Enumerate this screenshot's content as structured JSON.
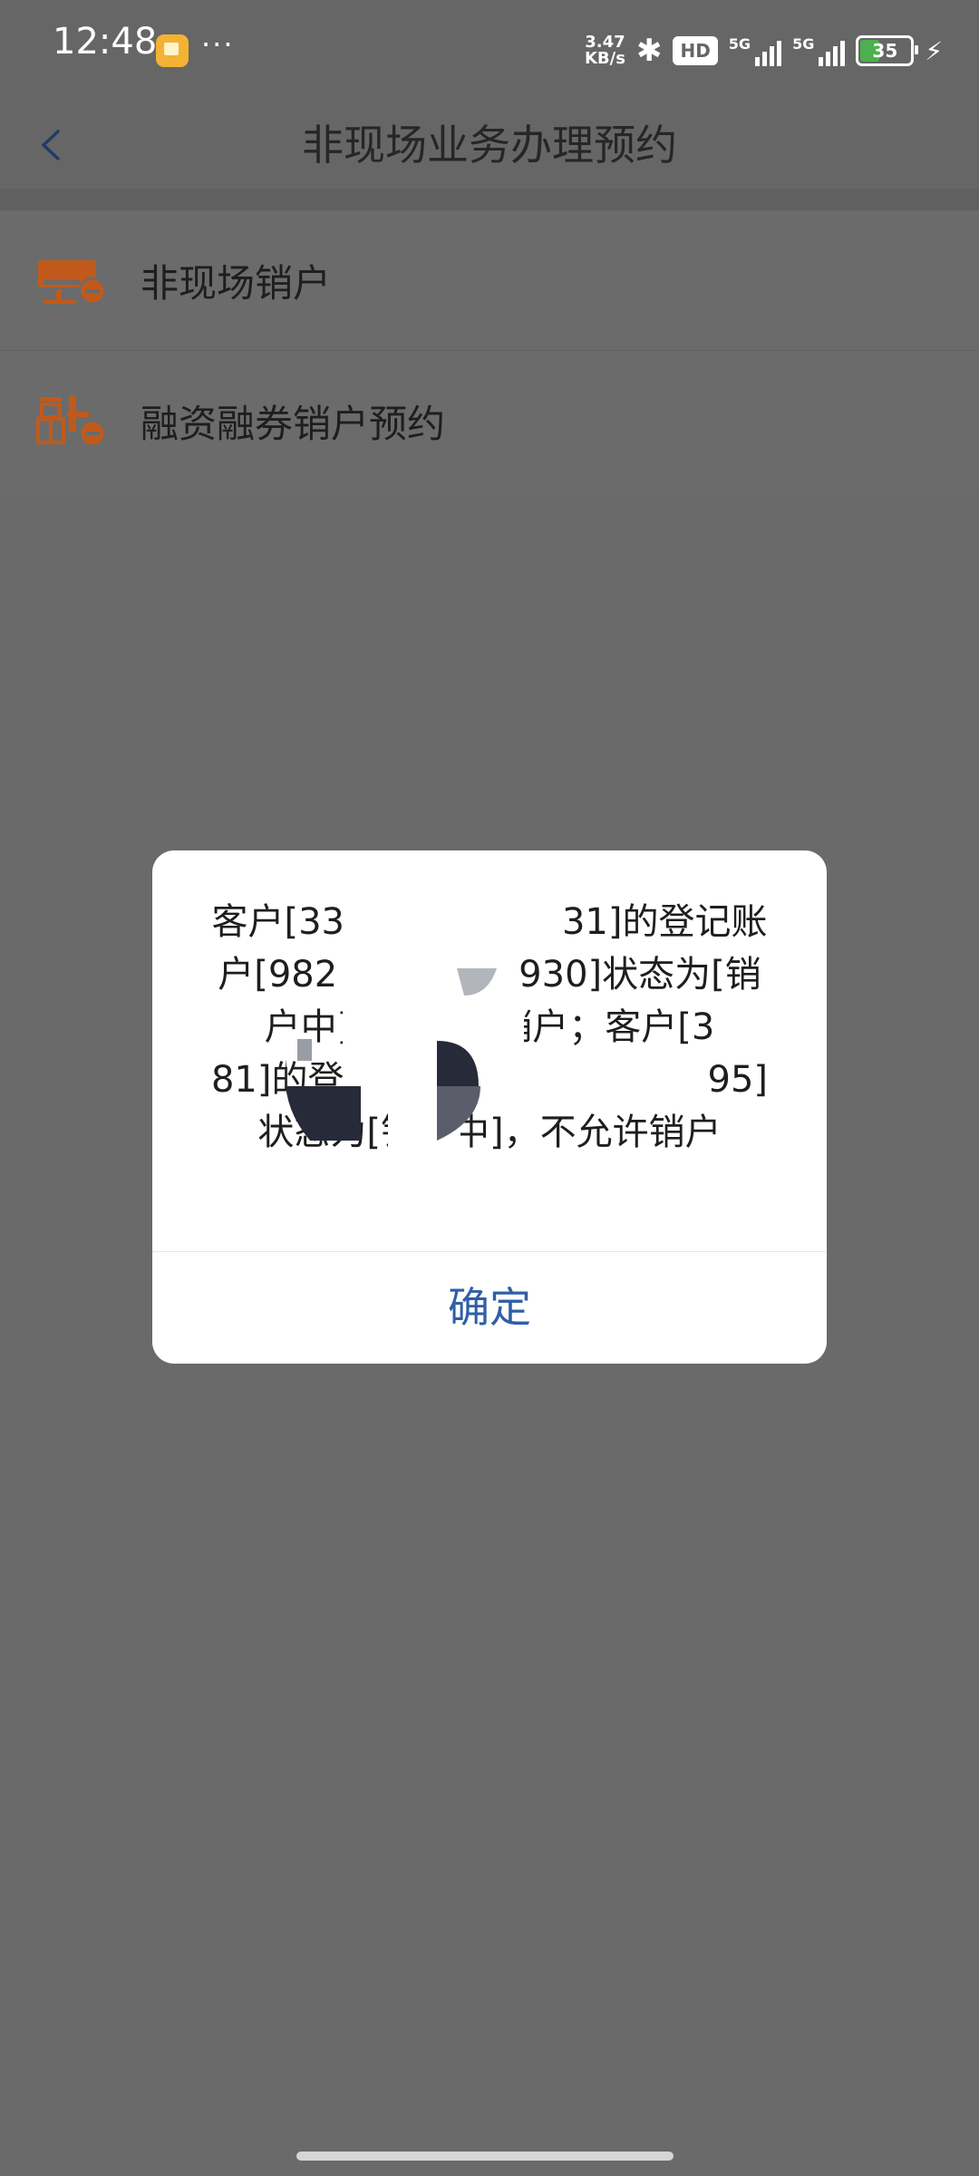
{
  "status_bar": {
    "time": "12:48",
    "more": "···",
    "speed_value": "3.47",
    "speed_unit": "KB/s",
    "hd_label": "HD",
    "network_1": "5G",
    "network_2": "5G",
    "battery": "35",
    "battery_level": 0.35,
    "icons": [
      "notification-icon",
      "bluetooth-icon",
      "hd-voice-icon",
      "signal-icon",
      "battery-icon",
      "charging-icon"
    ]
  },
  "header": {
    "title": "非现场业务办理预约",
    "back_icon": "chevron-left-icon"
  },
  "list": {
    "items": [
      {
        "label": "非现场销户",
        "icon": "account-close-icon"
      },
      {
        "label": "融资融券销户预约",
        "icon": "margin-close-icon"
      }
    ]
  },
  "dialog": {
    "message": "客户[33　　　　　　31]的登记账户[982　　　　　930]状态为[销户中]，不允许销户；客户[3　　　　　　81]的登记账户[9　　　　　　95]状态为[销户中]，不允许销户",
    "confirm_label": "确定"
  },
  "colors": {
    "overlay": "#6a6a6a",
    "accent": "#2f5fa6",
    "icon_brand": "#c05a1c",
    "dialog_bg": "#ffffff"
  }
}
